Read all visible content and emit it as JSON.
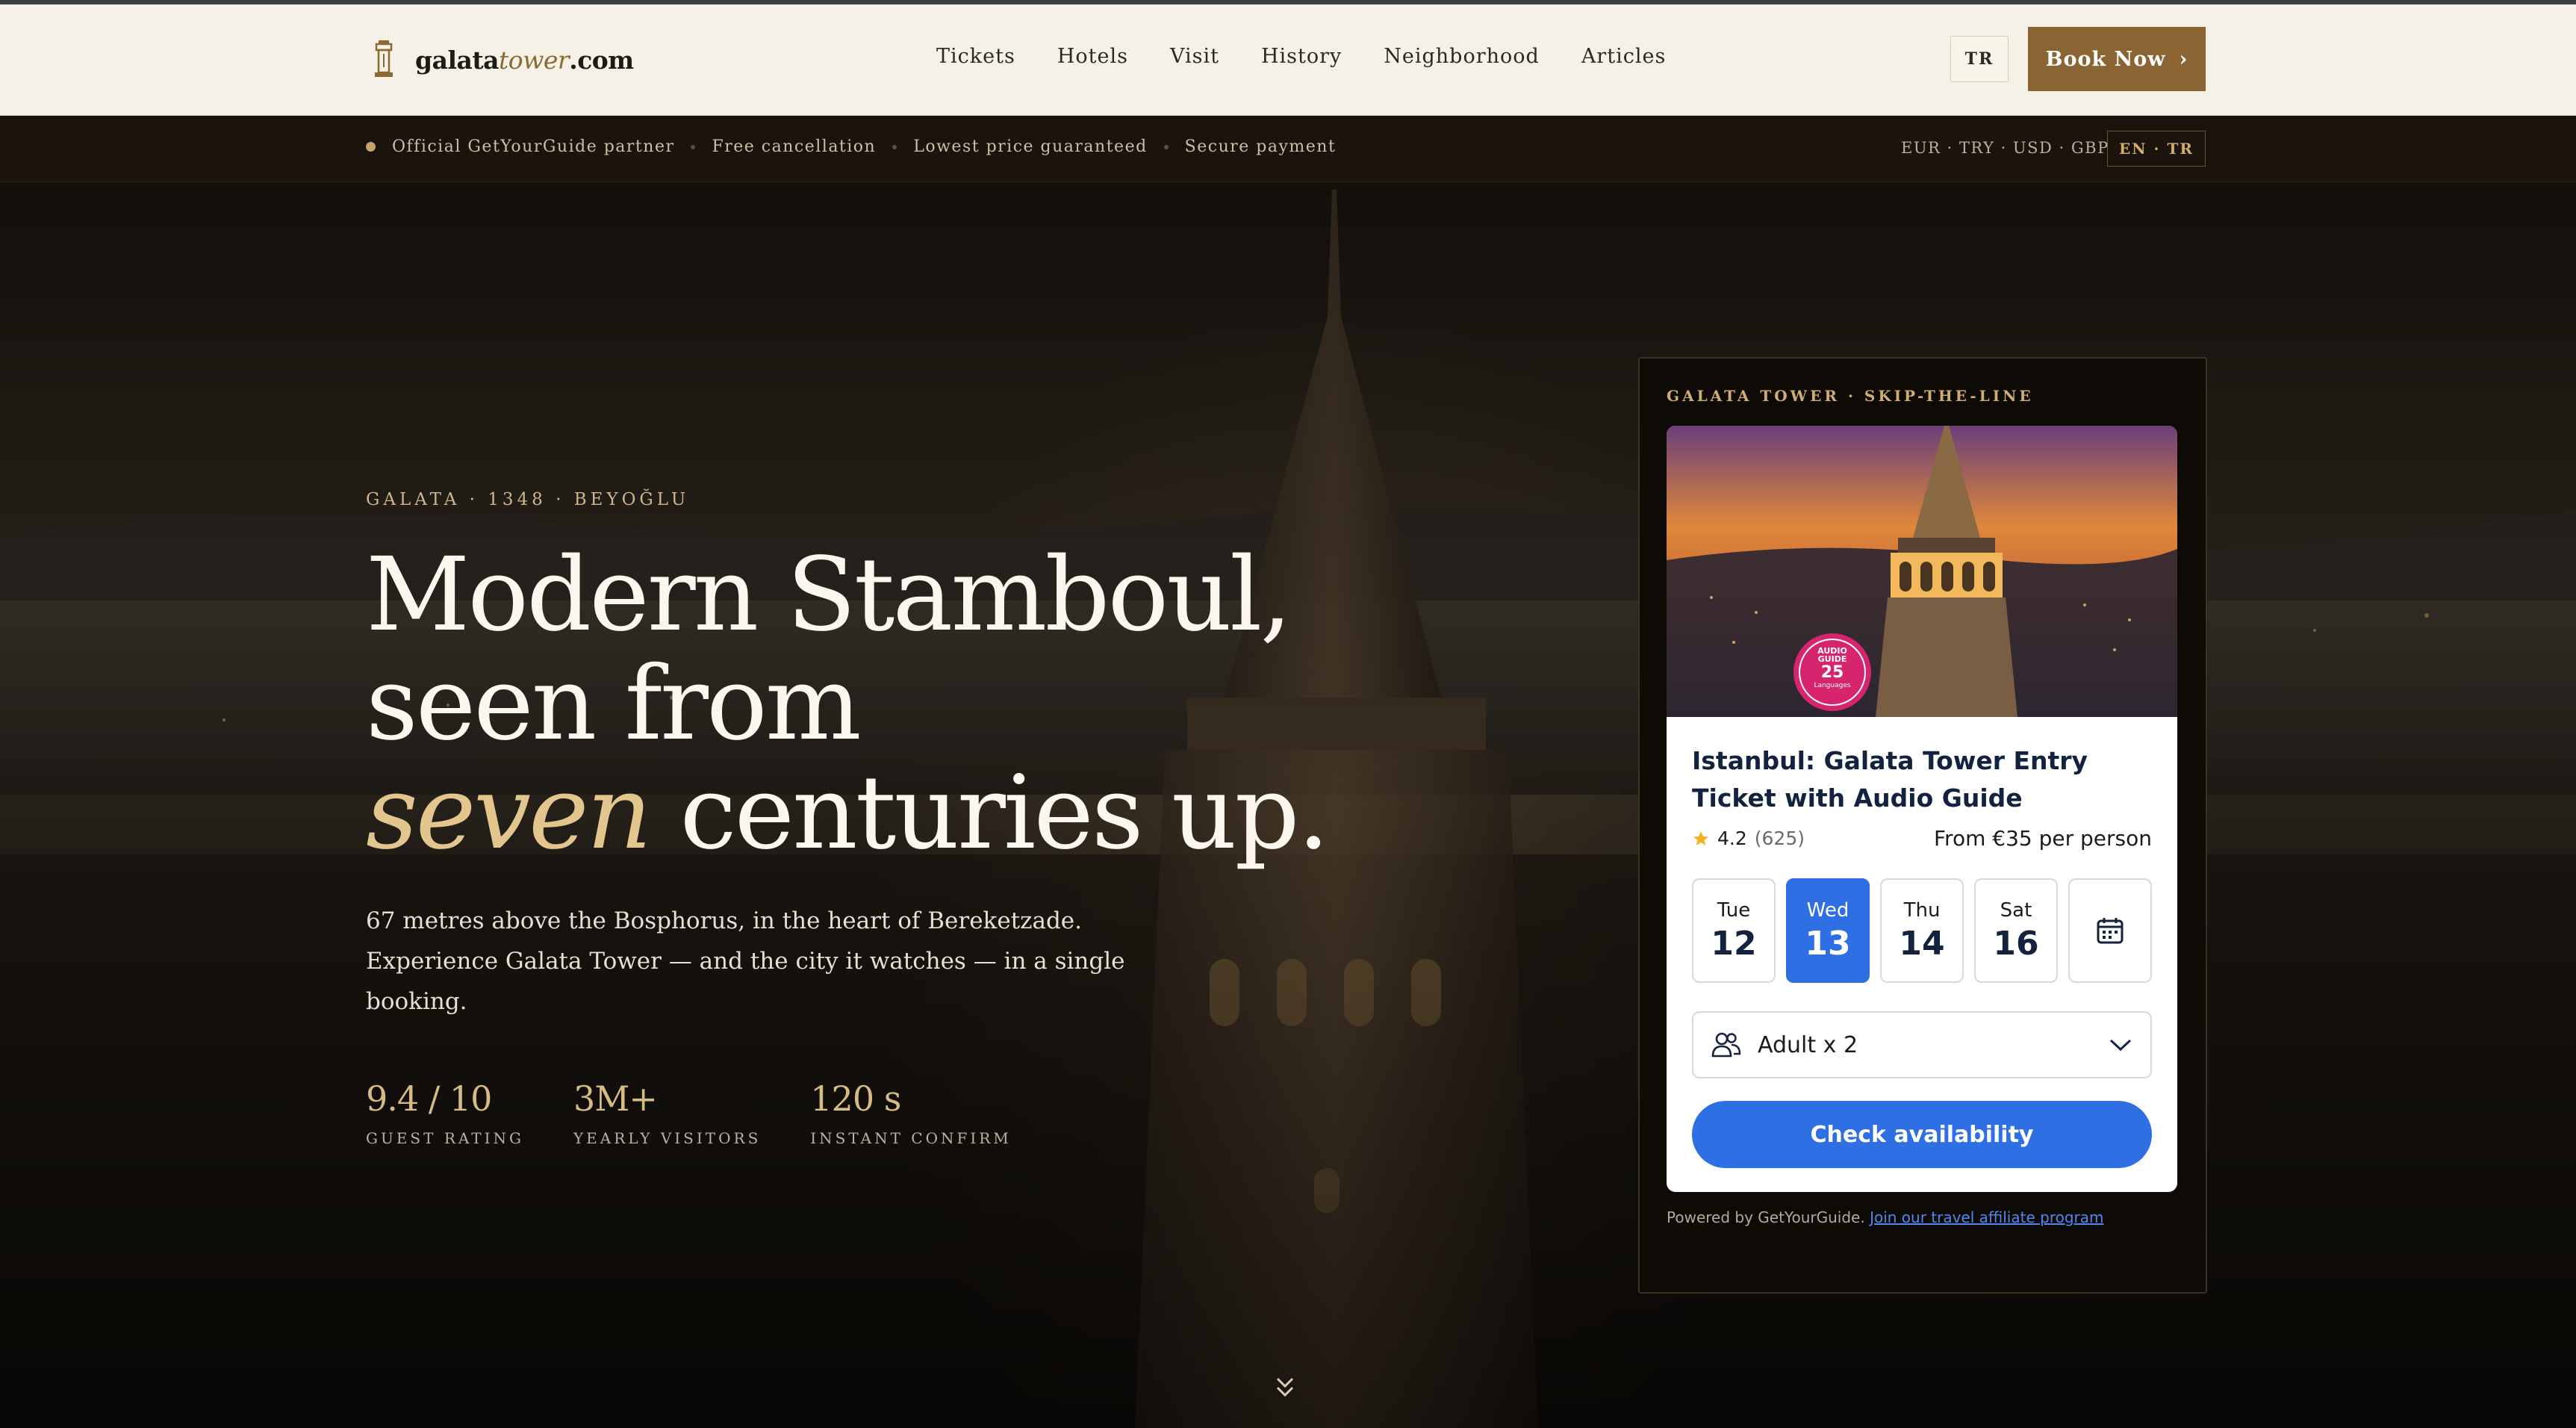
{
  "nav": {
    "logo_main": "galata",
    "logo_italic": "tower",
    "logo_suffix": ".com",
    "links": [
      "Tickets",
      "Hotels",
      "Visit",
      "History",
      "Neighborhood",
      "Articles"
    ],
    "lang_label": "TR",
    "book_label": "Book Now",
    "book_arrow": "›"
  },
  "strip": {
    "items": [
      "Official GetYourGuide partner",
      "Free cancellation",
      "Lowest price guaranteed",
      "Secure payment"
    ],
    "currencies": "EUR · TRY · USD · GBP",
    "locale_label": "EN · TR"
  },
  "hero": {
    "eyebrow": "GALATA · 1348 · BEYOĞLU",
    "headline_line1": "Modern Stamboul, seen from",
    "headline_accent": "seven",
    "headline_line2_rest": " centuries up.",
    "lede": "67 metres above the Bosphorus, in the heart of Bereketzade. Experience Galata Tower — and the city it watches — in a single booking.",
    "stats": [
      {
        "value": "9.4 / 10",
        "label": "GUEST RATING"
      },
      {
        "value": "3M+",
        "label": "YEARLY VISITORS"
      },
      {
        "value": "120 s",
        "label": "INSTANT CONFIRM"
      }
    ]
  },
  "booking": {
    "eyebrow": "GALATA TOWER · SKIP-THE-LINE",
    "photo_badge_line1": "AUDIO",
    "photo_badge_line2": "GUIDE",
    "photo_badge_number": "25",
    "photo_badge_sub": "Languages",
    "title": "Istanbul: Galata Tower Entry Ticket with Audio Guide",
    "rating_value": "4.2",
    "rating_count": "(625)",
    "price": "From €35 per person",
    "dates": [
      {
        "dow": "Tue",
        "dom": "12",
        "selected": false
      },
      {
        "dow": "Wed",
        "dom": "13",
        "selected": true
      },
      {
        "dow": "Thu",
        "dom": "14",
        "selected": false
      },
      {
        "dow": "Sat",
        "dom": "16",
        "selected": false
      }
    ],
    "participants": "Adult x 2",
    "cta": "Check availability",
    "powered_prefix": "Powered by GetYourGuide.",
    "powered_link": "Join our travel affiliate program"
  },
  "colors": {
    "nav_bg": "#f6f1e6",
    "gold": "#8a6432",
    "accent_text": "#e2c68d",
    "widget_blue": "#2f6fe4"
  },
  "icons": {
    "logo": "tower-icon",
    "rating": "star-icon",
    "calendar": "calendar-icon",
    "participants": "people-icon",
    "dropdown": "chevron-down-icon",
    "scroll": "double-chevron-down-icon"
  }
}
